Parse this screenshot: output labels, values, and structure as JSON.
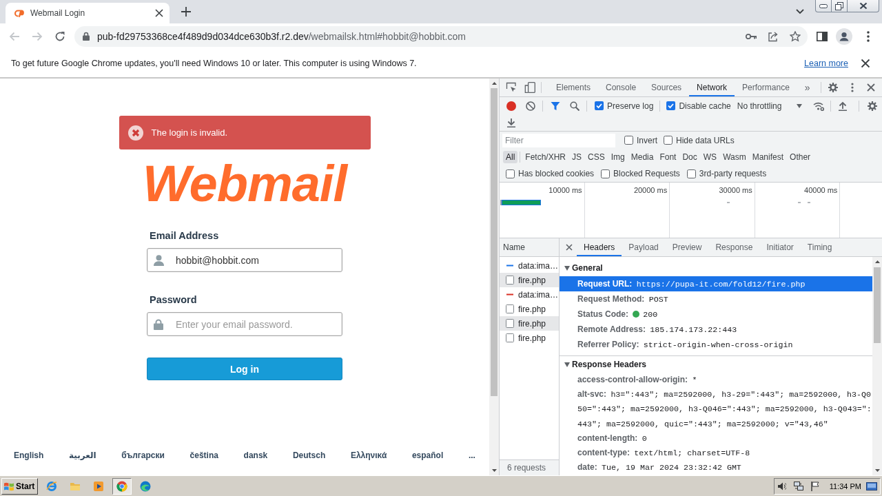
{
  "browser": {
    "tab": {
      "title": "Webmail Login"
    },
    "navigation": {
      "back_disabled": true,
      "forward_disabled": true
    },
    "address_bar": {
      "host": "pub-fd29753368ce4f489d9d034dce630b3f.r2.dev",
      "path": "/webmailsk.html#hobbit@hobbit.com"
    },
    "infobar": {
      "message": "To get future Google Chrome updates, you'll need Windows 10 or later. This computer is using Windows 7.",
      "link": "Learn more"
    }
  },
  "login_page": {
    "alert": {
      "message": "The login is invalid."
    },
    "logo_text": "Webmail",
    "fields": [
      {
        "kind": "email",
        "label": "Email Address",
        "value": "hobbit@hobbit.com"
      },
      {
        "kind": "password",
        "label": "Password",
        "placeholder": "Enter your email password."
      }
    ],
    "submit_button": "Log in",
    "languages": [
      "English",
      "العربية",
      "български",
      "čeština",
      "dansk",
      "Deutsch",
      "Ελληνικά",
      "español"
    ],
    "more_languages": "..."
  },
  "devtools": {
    "panel_tabs": [
      {
        "label": "Elements",
        "selected": false
      },
      {
        "label": "Console",
        "selected": false
      },
      {
        "label": "Sources",
        "selected": false
      },
      {
        "label": "Network",
        "selected": true
      },
      {
        "label": "Performance",
        "selected": false
      }
    ],
    "more_tabs": "»",
    "toolbar": {
      "recording": true,
      "filter_active": true,
      "checkboxes": [
        {
          "label": "Preserve log",
          "checked": true
        },
        {
          "label": "Disable cache",
          "checked": true
        }
      ],
      "throttling": "No throttling"
    },
    "filter": {
      "placeholder": "Filter",
      "options": [
        {
          "label": "Invert",
          "checked": false
        },
        {
          "label": "Hide data URLs",
          "checked": false
        }
      ]
    },
    "type_filters": [
      {
        "label": "All",
        "selected": true
      },
      {
        "label": "Fetch/XHR",
        "selected": false
      },
      {
        "label": "JS",
        "selected": false
      },
      {
        "label": "CSS",
        "selected": false
      },
      {
        "label": "Img",
        "selected": false
      },
      {
        "label": "Media",
        "selected": false
      },
      {
        "label": "Font",
        "selected": false
      },
      {
        "label": "Doc",
        "selected": false
      },
      {
        "label": "WS",
        "selected": false
      },
      {
        "label": "Wasm",
        "selected": false
      },
      {
        "label": "Manifest",
        "selected": false
      },
      {
        "label": "Other",
        "selected": false
      }
    ],
    "blocked_filters": [
      {
        "label": "Has blocked cookies",
        "checked": false
      },
      {
        "label": "Blocked Requests",
        "checked": false
      },
      {
        "label": "3rd-party requests",
        "checked": false
      }
    ],
    "overview": {
      "time_labels": [
        "10000 ms",
        "20000 ms",
        "30000 ms",
        "40000 ms"
      ]
    },
    "requests": {
      "column": "Name",
      "rows": [
        {
          "kind": "data",
          "name": "data:ima…",
          "color": "#1a73e8",
          "selected": false
        },
        {
          "kind": "document",
          "name": "fire.php",
          "selected": true
        },
        {
          "kind": "data",
          "name": "data:ima…",
          "color": "#d93025",
          "selected": false
        },
        {
          "kind": "document",
          "name": "fire.php",
          "selected": false
        },
        {
          "kind": "document",
          "name": "fire.php",
          "selected": true
        },
        {
          "kind": "document",
          "name": "fire.php",
          "selected": false
        }
      ],
      "summary": "6 requests"
    },
    "details": {
      "tabs": [
        {
          "label": "Headers",
          "selected": true
        },
        {
          "label": "Payload",
          "selected": false
        },
        {
          "label": "Preview",
          "selected": false
        },
        {
          "label": "Response",
          "selected": false
        },
        {
          "label": "Initiator",
          "selected": false
        },
        {
          "label": "Timing",
          "selected": false
        }
      ],
      "sections": [
        {
          "title": "General",
          "expanded": true,
          "rows": [
            {
              "key": "Request URL:",
              "value": "https://pupa-it.com/fold12/fire.php",
              "selected": true
            },
            {
              "key": "Request Method:",
              "value": "POST",
              "selected": false
            },
            {
              "key": "Status Code:",
              "value": "200",
              "selected": false,
              "color": "#34a853"
            },
            {
              "key": "Remote Address:",
              "value": "185.174.173.22:443",
              "selected": false
            },
            {
              "key": "Referrer Policy:",
              "value": "strict-origin-when-cross-origin",
              "selected": false
            }
          ]
        },
        {
          "title": "Response Headers",
          "expanded": true,
          "rows": [
            {
              "key": "access-control-allow-origin:",
              "value": "*",
              "selected": false
            },
            {
              "key": "alt-svc:",
              "value": "h3=\":443\"; ma=2592000, h3-29=\":443\"; ma=2592000, h3-Q050=\":443\"; ma=2592000, h3-Q046=\":443\"; ma=2592000, h3-Q043=\":443\"; ma=2592000, quic=\":443\"; ma=2592000; v=\"43,46\"",
              "selected": false
            },
            {
              "key": "content-length:",
              "value": "0",
              "selected": false
            },
            {
              "key": "content-type:",
              "value": "text/html; charset=UTF-8",
              "selected": false
            },
            {
              "key": "date:",
              "value": "Tue, 19 Mar 2024 23:32:42 GMT",
              "selected": false
            }
          ]
        }
      ]
    }
  },
  "taskbar": {
    "start": "Start",
    "apps": [
      {
        "kind": "ie",
        "selected": false
      },
      {
        "kind": "explorer",
        "selected": false
      },
      {
        "kind": "mediaplayer",
        "selected": false
      },
      {
        "kind": "chrome",
        "selected": true
      },
      {
        "kind": "edge",
        "selected": false
      }
    ],
    "clock": "11:34 PM"
  }
}
